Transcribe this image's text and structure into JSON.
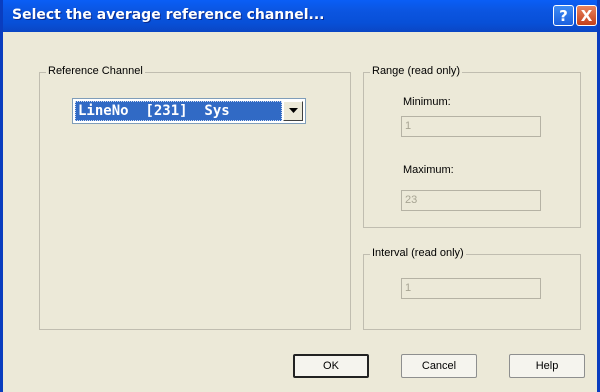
{
  "window": {
    "title": "Select the average reference channel...",
    "help_glyph": "?",
    "close_glyph": "X"
  },
  "reference_group": {
    "label": "Reference Channel",
    "combo": {
      "selected_value": "LineNo  [231]  Sys",
      "arrow_icon": "dropdown-arrow-icon"
    }
  },
  "range_group": {
    "label": "Range (read only)",
    "minimum_label": "Minimum:",
    "minimum_value": "1",
    "maximum_label": "Maximum:",
    "maximum_value": "23"
  },
  "interval_group": {
    "label": "Interval (read only)",
    "value": "1"
  },
  "buttons": {
    "ok": "OK",
    "cancel": "Cancel",
    "help": "Help"
  },
  "colors": {
    "titlebar": "#0a5ef6",
    "selection": "#316ac5",
    "dialog_bg": "#ece9d8"
  }
}
